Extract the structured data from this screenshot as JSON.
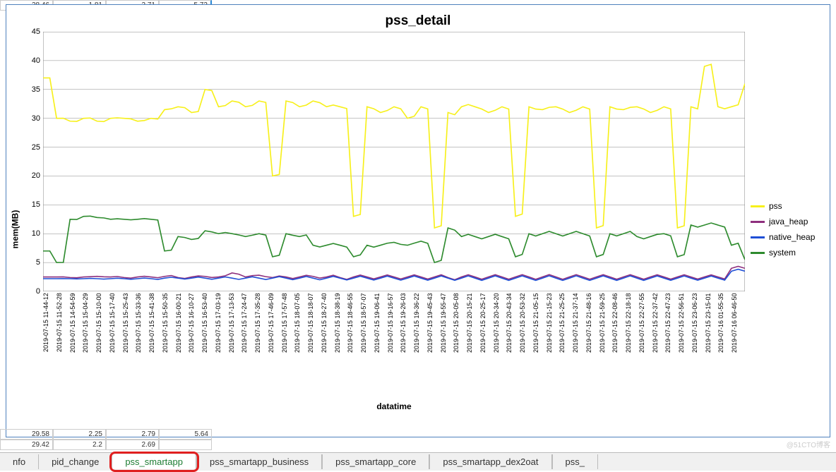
{
  "background_cells": {
    "row1": [
      "28.46",
      "1.81",
      "2.71",
      "5.72"
    ]
  },
  "bottom_cells": {
    "row1": [
      "29.58",
      "2.25",
      "2.79",
      "5.64"
    ],
    "row2": [
      "29.42",
      "2.2",
      "2.69",
      ""
    ]
  },
  "tabs": {
    "t0": "nfo",
    "t1": "pid_change",
    "t2": "pss_smartapp",
    "t3": "pss_smartapp_business",
    "t4": "pss_smartapp_core",
    "t5": "pss_smartapp_dex2oat",
    "t6": "pss_"
  },
  "chart": {
    "title": "pss_detail",
    "ylabel": "mem(MB)",
    "xlabel": "datatime",
    "legend": {
      "pss": "pss",
      "java_heap": "java_heap",
      "native_heap": "native_heap",
      "system": "system"
    }
  },
  "watermark": "@51CTO博客",
  "chart_data": {
    "type": "line",
    "title": "pss_detail",
    "xlabel": "datatime",
    "ylabel": "mem(MB)",
    "ylim": [
      0,
      45
    ],
    "yticks": [
      0,
      5,
      10,
      15,
      20,
      25,
      30,
      35,
      40,
      45
    ],
    "categories": [
      "2019-07-15 11-44-12",
      "2019-07-15 11-52-28",
      "2019-07-15 14-54-59",
      "2019-07-15 15-04-29",
      "2019-07-15 15-10-00",
      "2019-07-15 15-17-40",
      "2019-07-15 15-25-43",
      "2019-07-15 15-33-36",
      "2019-07-15 15-41-38",
      "2019-07-15 15-50-35",
      "2019-07-15 16-00-21",
      "2019-07-15 16-10-27",
      "2019-07-15 16-53-40",
      "2019-07-15 17-03-19",
      "2019-07-15 17-13-53",
      "2019-07-15 17-24-47",
      "2019-07-15 17-35-28",
      "2019-07-15 17-46-09",
      "2019-07-15 17-57-48",
      "2019-07-15 18-07-05",
      "2019-07-15 18-18-07",
      "2019-07-15 18-27-40",
      "2019-07-15 18-38-19",
      "2019-07-15 18-46-55",
      "2019-07-15 18-57-07",
      "2019-07-15 19-06-41",
      "2019-07-15 19-16-57",
      "2019-07-15 19-26-03",
      "2019-07-15 19-36-22",
      "2019-07-15 19-45-43",
      "2019-07-15 19-55-47",
      "2019-07-15 20-05-08",
      "2019-07-15 20-15-21",
      "2019-07-15 20-25-17",
      "2019-07-15 20-34-20",
      "2019-07-15 20-43-34",
      "2019-07-15 20-53-32",
      "2019-07-15 21-05-15",
      "2019-07-15 21-15-23",
      "2019-07-15 21-25-25",
      "2019-07-15 21-37-14",
      "2019-07-15 21-48-16",
      "2019-07-15 21-59-25",
      "2019-07-15 22-08-46",
      "2019-07-15 22-18-18",
      "2019-07-15 22-27-55",
      "2019-07-15 22-37-42",
      "2019-07-15 22-47-23",
      "2019-07-15 22-56-51",
      "2019-07-15 23-06-23",
      "2019-07-15 23-15-01",
      "2019-07-16 01-55-35",
      "2019-07-16 06-46-50"
    ],
    "series": [
      {
        "name": "pss",
        "color": "#f7f01a",
        "values": [
          37,
          30,
          29.5,
          30,
          29.5,
          30,
          30,
          29.5,
          30,
          31.5,
          32,
          31,
          35,
          32,
          33,
          32,
          33,
          20,
          33,
          32,
          33,
          32,
          32,
          13,
          32,
          31,
          32,
          30,
          32,
          11,
          31,
          32,
          32,
          31,
          32,
          13,
          32,
          31.5,
          32,
          31,
          32,
          11,
          32,
          31.5,
          32,
          31,
          32,
          11,
          32,
          39,
          32,
          32,
          36
        ]
      },
      {
        "name": "java_heap",
        "color": "#8e2f7d",
        "values": [
          2.5,
          2.5,
          2.4,
          2.5,
          2.6,
          2.5,
          2.4,
          2.5,
          2.5,
          2.6,
          2.4,
          2.5,
          2.6,
          2.5,
          3.2,
          2.5,
          2.8,
          2.4,
          2.5,
          2.5,
          2.6,
          2.5,
          2.4,
          2.5,
          2.5,
          2.5,
          2.5,
          2.5,
          2.5,
          2.5,
          2.4,
          2.5,
          2.5,
          2.5,
          2.5,
          2.5,
          2.5,
          2.5,
          2.5,
          2.5,
          2.5,
          2.5,
          2.5,
          2.5,
          2.5,
          2.5,
          2.5,
          2.5,
          2.5,
          2.5,
          2.5,
          4.0,
          4.0
        ]
      },
      {
        "name": "native_heap",
        "color": "#1f4fd6",
        "values": [
          2.2,
          2.2,
          2.2,
          2.2,
          2.2,
          2.2,
          2.2,
          2.2,
          2.2,
          2.3,
          2.3,
          2.3,
          2.3,
          2.3,
          2.3,
          2.3,
          2.3,
          2.3,
          2.3,
          2.3,
          2.3,
          2.3,
          2.3,
          2.3,
          2.3,
          2.3,
          2.3,
          2.3,
          2.3,
          2.3,
          2.3,
          2.3,
          2.3,
          2.3,
          2.3,
          2.3,
          2.3,
          2.3,
          2.3,
          2.3,
          2.3,
          2.3,
          2.3,
          2.3,
          2.3,
          2.3,
          2.3,
          2.3,
          2.3,
          2.3,
          2.3,
          3.5,
          3.5
        ]
      },
      {
        "name": "system",
        "color": "#2e8b2e",
        "values": [
          7,
          5,
          12.5,
          13,
          12.8,
          12.5,
          12.5,
          12.5,
          12.5,
          7,
          9.5,
          9,
          10.5,
          10,
          10,
          9.5,
          10,
          6,
          10,
          9.5,
          8,
          8,
          8,
          6,
          8,
          8,
          8.5,
          8,
          8.7,
          5,
          11,
          9.5,
          9.5,
          9.5,
          9.5,
          6,
          10,
          10,
          10,
          10,
          10,
          6,
          10,
          10,
          9.5,
          9.5,
          10,
          6,
          11.5,
          11.5,
          11.5,
          8,
          5.5
        ]
      }
    ]
  }
}
